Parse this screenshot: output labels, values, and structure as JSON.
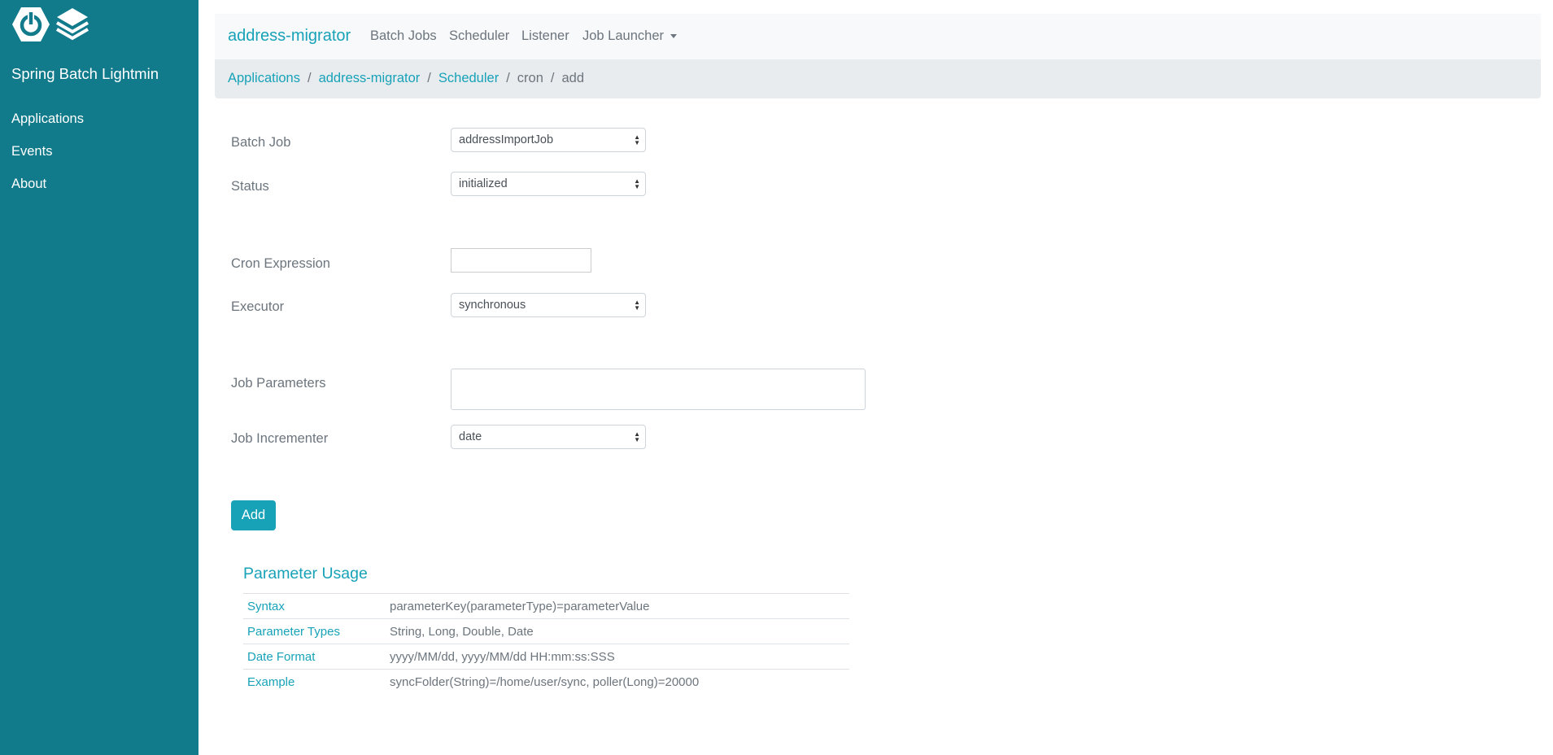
{
  "sidebar": {
    "title": "Spring Batch Lightmin",
    "items": [
      {
        "label": "Applications"
      },
      {
        "label": "Events"
      },
      {
        "label": "About"
      }
    ],
    "color": "#117a8b"
  },
  "navbar": {
    "brand": "address-migrator",
    "items": [
      {
        "label": "Batch Jobs"
      },
      {
        "label": "Scheduler"
      },
      {
        "label": "Listener"
      },
      {
        "label": "Job Launcher"
      }
    ]
  },
  "breadcrumb": [
    "Applications",
    "address-migrator",
    "Scheduler",
    "cron",
    "add"
  ],
  "form": {
    "batch_job": {
      "label": "Batch Job",
      "value": "addressImportJob"
    },
    "status": {
      "label": "Status",
      "value": "initialized"
    },
    "cron": {
      "label": "Cron Expression",
      "value": ""
    },
    "executor": {
      "label": "Executor",
      "value": "synchronous"
    },
    "job_parameters": {
      "label": "Job Parameters",
      "value": ""
    },
    "job_incrementer": {
      "label": "Job Incrementer",
      "value": "date"
    },
    "add_label": "Add"
  },
  "usage": {
    "title": "Parameter Usage",
    "rows": [
      {
        "key": "Syntax",
        "value": "parameterKey(parameterType)=parameterValue"
      },
      {
        "key": "Parameter Types",
        "value": "String, Long, Double, Date"
      },
      {
        "key": "Date Format",
        "value": "yyyy/MM/dd, yyyy/MM/dd HH:mm:ss:SSS"
      },
      {
        "key": "Example",
        "value": "syncFolder(String)=/home/user/sync, poller(Long)=20000"
      }
    ]
  },
  "accent": "#17a2b8"
}
